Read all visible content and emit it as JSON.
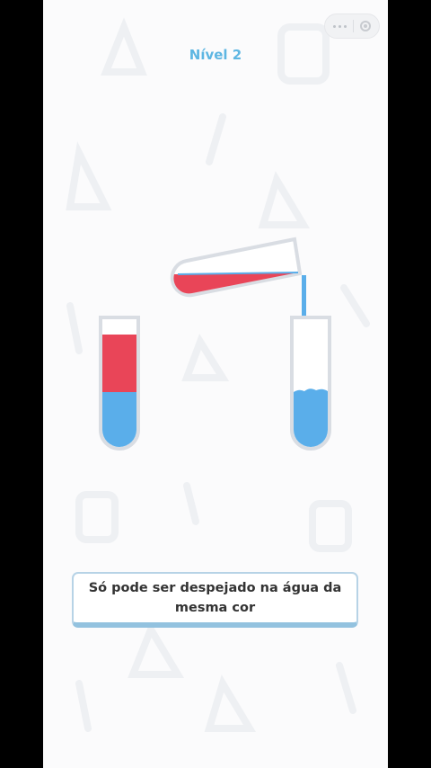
{
  "header": {
    "level_label": "Nível 2",
    "capsule": {
      "more_icon": "more-dots-icon",
      "close_icon": "close-circle-icon"
    }
  },
  "game": {
    "colors": {
      "red": "#e94558",
      "blue": "#5aaeea",
      "glass_outline": "#d9dde3",
      "background": "#fbfbfc",
      "accent": "#5db6e2"
    },
    "tubes": [
      {
        "id": "tube-left",
        "layers_bottom_to_top": [
          "blue",
          "red"
        ],
        "state": "resting"
      },
      {
        "id": "tube-pouring",
        "layers_bottom_to_top": [
          "red"
        ],
        "state": "tilted-pouring"
      },
      {
        "id": "tube-right",
        "layers_bottom_to_top": [
          "blue"
        ],
        "state": "receiving"
      }
    ]
  },
  "hint": {
    "message": "Só pode ser despejado na água da mesma cor"
  }
}
